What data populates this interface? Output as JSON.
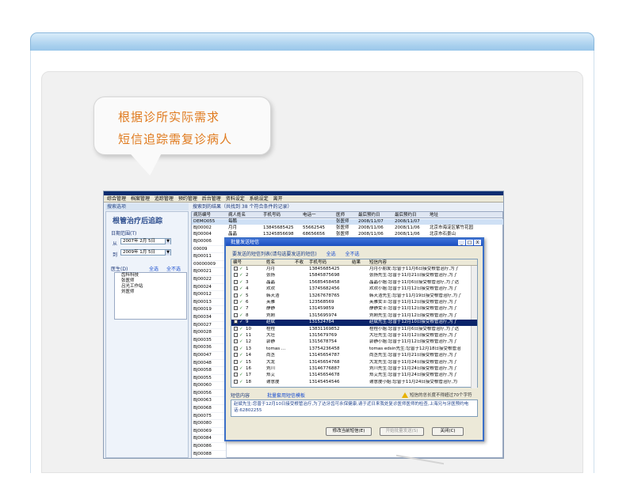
{
  "bubble": {
    "line1": "根据诊所实际需求",
    "line2": "短信追踪需复诊病人"
  },
  "app": {
    "menu": [
      "综合管理",
      "档案管理",
      "追踪管理",
      "预约管理",
      "后台管理",
      "资料设定",
      "系统设定",
      "离开"
    ],
    "left_header": "搜索选项",
    "brand": "根管治疗后追踪",
    "date_range_label": "日期范围(T)",
    "from_label": "从",
    "from_date": "2007年 2月 5日",
    "to_label": "到",
    "to_date": "2009年 1月 5日",
    "doctor_label": "医生(D)",
    "select_all": "全选",
    "deselect_all": "全不选",
    "tree_items": [
      "齿科科技",
      "张医师",
      "吕光工作站",
      "刘医师"
    ],
    "result_header": "搜索到的结果（共找到 38 个符合条件的记录）",
    "grid_headers": [
      "病历编号",
      "病人姓名",
      "手机号码",
      "电话一",
      "医师",
      "最后预约日",
      "最后预约日",
      "地址"
    ],
    "top_rows": [
      {
        "id": "DEMO055",
        "name": "每鹏",
        "doctor": "张医师",
        "d1": "2008/11/07",
        "d2": "2008/11/07",
        "addr": ""
      },
      {
        "id": "BJ00002",
        "name": "月月",
        "mobile": "13845685425",
        "phone": "55662545",
        "doctor": "张医师",
        "d1": "2008/11/06",
        "d2": "2008/11/06",
        "addr": "北京市海淀区紫竹花园"
      },
      {
        "id": "BJ00004",
        "name": "晶晶",
        "mobile": "13245856698",
        "phone": "68656656",
        "doctor": "张医师",
        "d1": "2008/11/06",
        "d2": "2008/11/06",
        "addr": "北京市石景山"
      }
    ],
    "ids": [
      "BJ00006",
      "00009",
      "BJ00011",
      "00000009",
      "BJ00021",
      "BJ00022",
      "BJ00024",
      "BJ00012",
      "BJ00013",
      "BJ00019",
      "BJ00034",
      "BJ00027",
      "BJ00028",
      "BJ00035",
      "BJ00036",
      "BJ00047",
      "BJ00048",
      "BJ00058",
      "BJ00055",
      "BJ00060",
      "BJ00056",
      "BJ00063",
      "BJ00068",
      "BJ00075",
      "BJ00080",
      "BJ00069",
      "BJ00084",
      "BJ00086",
      "BJ00088"
    ]
  },
  "dialog": {
    "title": "批量发送短信",
    "win_buttons": [
      "_",
      "□",
      "X"
    ],
    "hint": "要发送的短信列表(请勾选要发送的短信)",
    "select_all": "全选",
    "deselect_all": "全不选",
    "headers": [
      "编号",
      "姓名",
      "不收",
      "手机号码",
      "结果",
      "短信内容"
    ],
    "rows": [
      {
        "no": "1",
        "name": "月月",
        "mobile": "13845685425",
        "text": "月月小朋友:您曾于11月6日接受根管治疗,为了"
      },
      {
        "no": "2",
        "name": "张扬",
        "mobile": "15845875698",
        "text": "张扬先生:您曾于11月21日接受根管治疗,为了"
      },
      {
        "no": "3",
        "name": "晶晶",
        "mobile": "15685458458",
        "text": "晶晶小姐:您曾于11月6日接受根管治疗,为了达"
      },
      {
        "no": "4",
        "name": "欢欢",
        "mobile": "13745682456",
        "text": "欢欢小姐:您曾于11月12日接受根管治疗,为了"
      },
      {
        "no": "5",
        "name": "韩天浩",
        "mobile": "13267678765",
        "text": "韩天浩先生:您曾于11月19日接受根管治疗,为了"
      },
      {
        "no": "6",
        "name": "芙雅",
        "mobile": "123568569",
        "text": "芙雅女士:您曾于11月12日接受根管治疗,为了"
      },
      {
        "no": "7",
        "name": "静静",
        "mobile": "131459859",
        "text": "静静女士:您曾于11月12日接受根管治疗,为了"
      },
      {
        "no": "8",
        "name": "刘刚",
        "mobile": "1315695974",
        "text": "刘刚先生:您曾于11月12日接受根管治疗,为了"
      },
      {
        "no": "9",
        "name": "赵斌",
        "mobile": "131524784",
        "text": "赵斌先生:您曾于12月10日接受根管治疗,为了",
        "selected": true
      },
      {
        "no": "10",
        "name": "程程",
        "mobile": "13831169852",
        "text": "程程小姐:您曾于11月6日接受根管治疗,为了达"
      },
      {
        "no": "11",
        "name": "大壮",
        "mobile": "1315679769",
        "text": "大壮先生:您曾于11月12日接受根管治疗,为了"
      },
      {
        "no": "12",
        "name": "郭静",
        "mobile": "1315678754",
        "text": "郭静小姐:您曾于11月12日接受根管治疗,为了"
      },
      {
        "no": "13",
        "name": "tomas ...",
        "mobile": "13754236458",
        "text": "tomas edsin先生:您曾于12月18日接受根管治"
      },
      {
        "no": "14",
        "name": "尚丞",
        "mobile": "13145654787",
        "text": "尚丞先生:您曾于11月21日接受根管治疗,为了"
      },
      {
        "no": "15",
        "name": "大龙",
        "mobile": "13145654768",
        "text": "大龙先生:您曾于11月24日接受根管治疗,为了"
      },
      {
        "no": "16",
        "name": "刘川",
        "mobile": "13146776887",
        "text": "刘川先生:您曾于11月24日接受根管治疗,为了"
      },
      {
        "no": "17",
        "name": "郑艾",
        "mobile": "13145654678",
        "text": "郑艾先生:您曾于11月24日接受根管治疗,为了"
      },
      {
        "no": "18",
        "name": "谢意虔",
        "mobile": "13145454546",
        "text": "谢意虔小姐:您曾于11月24日接受根管治疗,为"
      }
    ],
    "sms_label": "短信内容",
    "template_link": "批量套用短信模板",
    "warning": "短信的总长度不得超过70个字符",
    "message": "赵斌先生:您曾于12月10日接受根管治疗,为了达牙齿可永保健康,请于近日来我处复诊医师医师的检查,上海兄与牙医预约电话:62802255",
    "buttons": [
      "修改当前短信(E)",
      "开始批量发送(S)",
      "关闭(C)"
    ]
  }
}
